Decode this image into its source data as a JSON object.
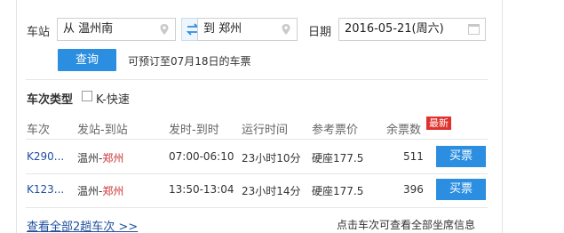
{
  "search": {
    "station_label": "车站",
    "from_value": "从 温州南",
    "to_value": "到 郑州",
    "date_label": "日期",
    "date_value": "2016-05-21(周六)",
    "query_label": "查询",
    "presale_text": "可预订至07月18日的车票"
  },
  "filter": {
    "title": "车次类型",
    "option_label": "K-快速",
    "option_checked": false
  },
  "table": {
    "headers": [
      "车次",
      "发站-到站",
      "发时-到时",
      "运行时间",
      "参考票价",
      "余票数"
    ],
    "new_badge": "最新",
    "rows": [
      {
        "train": "K290...",
        "from": "温州-",
        "to": "郑州",
        "times": "07:00-06:10",
        "duration": "23小时10分",
        "price": "硬座177.5",
        "remaining": "511",
        "buy": "买票"
      },
      {
        "train": "K123...",
        "from": "温州-",
        "to": "郑州",
        "times": "13:50-13:04",
        "duration": "23小时14分",
        "price": "硬座177.5",
        "remaining": "396",
        "buy": "买票"
      }
    ]
  },
  "footer": {
    "view_all": "查看全部2趟车次 >>",
    "tip": "点击车次可查看全部坐席信息"
  },
  "colors": {
    "accent": "#2b8ee0",
    "link": "#1f4f9f",
    "badge": "#e0322c",
    "arrival_station": "#cc3333"
  }
}
